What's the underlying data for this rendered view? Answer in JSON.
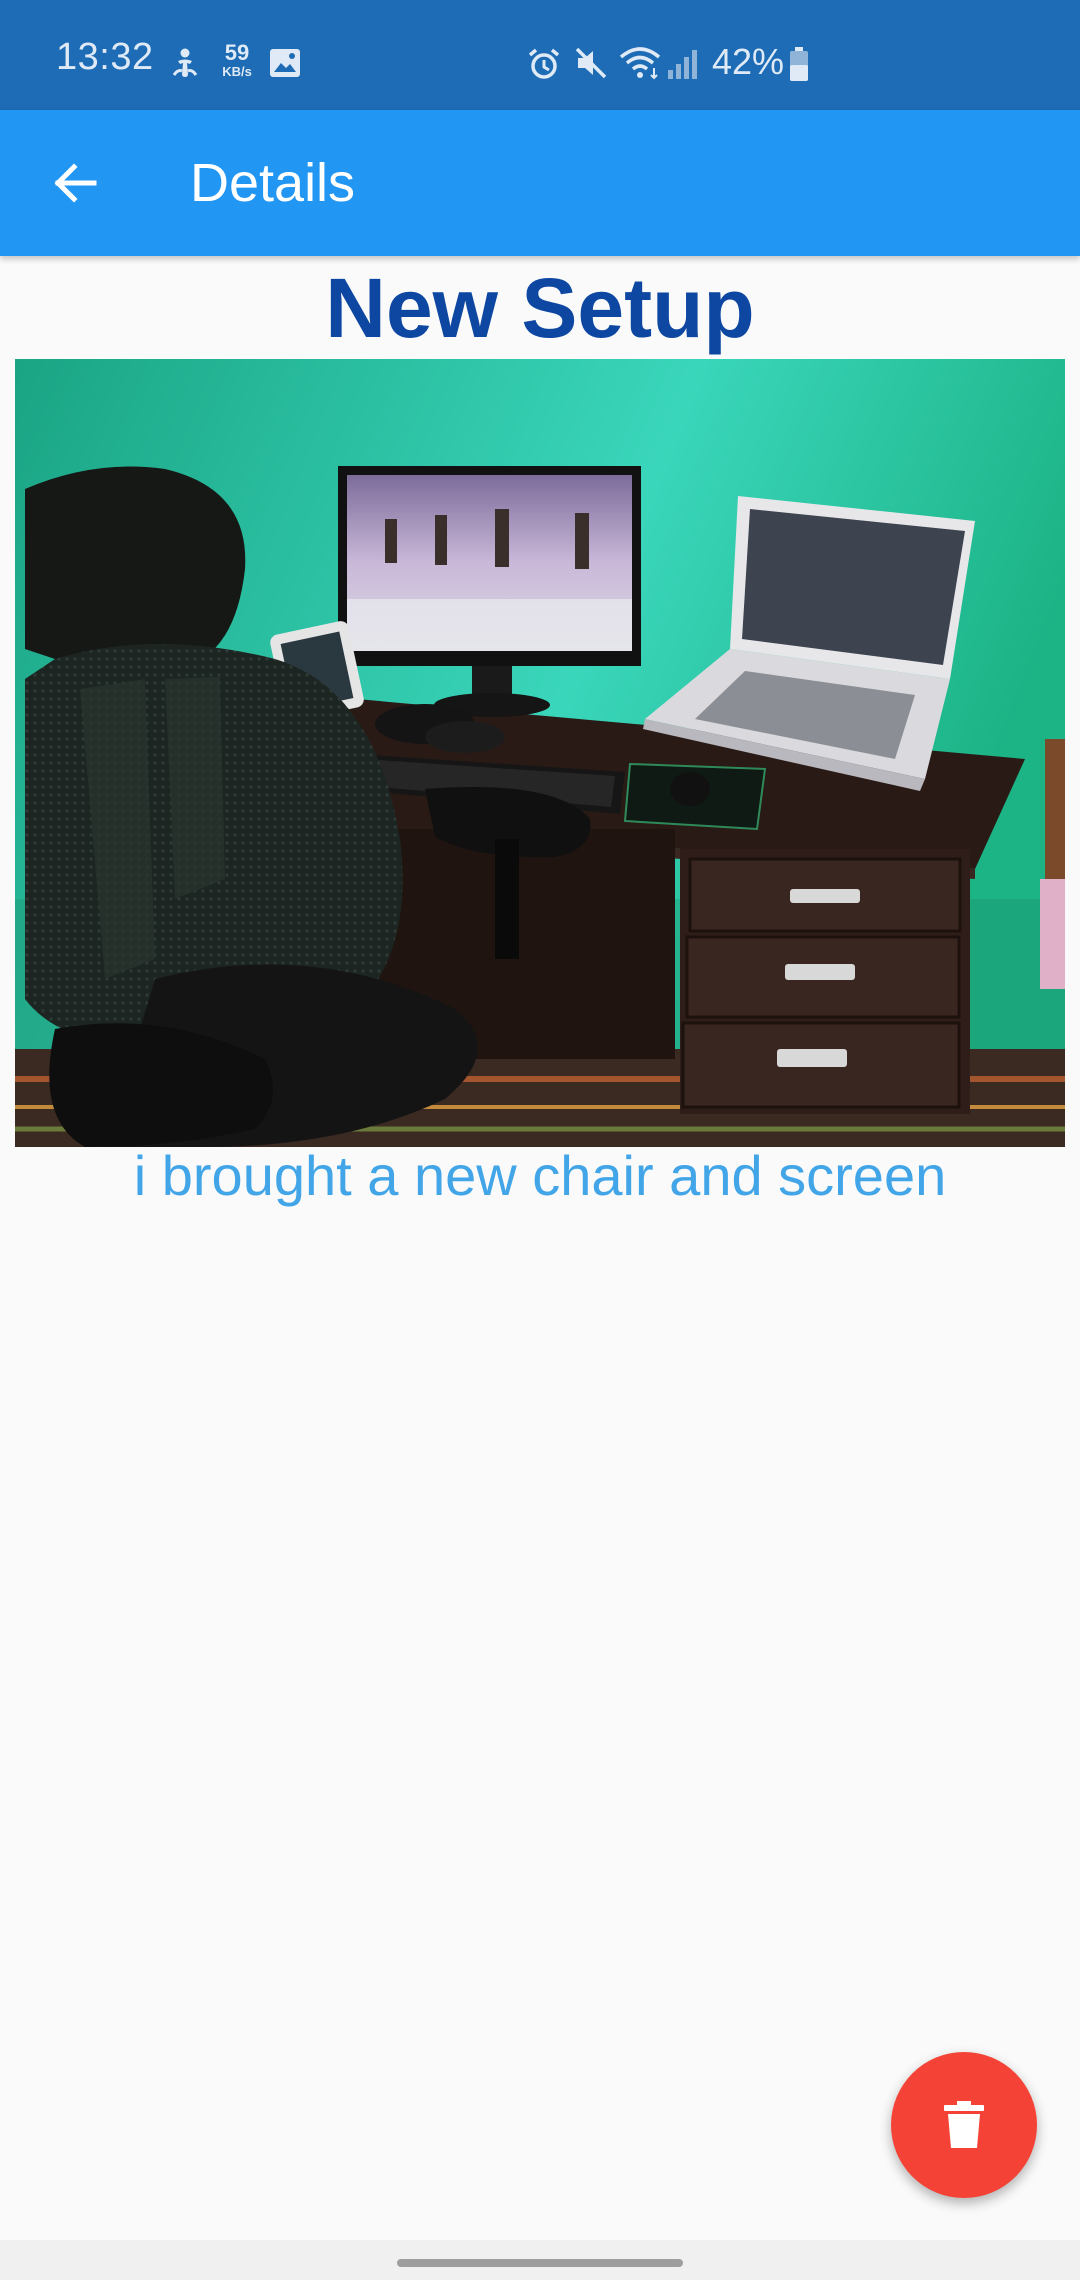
{
  "status_bar": {
    "time": "13:32",
    "net_speed_value": "59",
    "net_speed_unit": "KB/s",
    "battery_percent": "42%",
    "icons": [
      "accessibility-icon",
      "image-icon",
      "alarm-icon",
      "mute-icon",
      "wifi-icon",
      "signal-icon",
      "battery-icon"
    ]
  },
  "app_bar": {
    "title": "Details",
    "back_icon": "arrow-left-icon"
  },
  "post": {
    "title": "New Setup",
    "caption": "i brought a new chair and screen",
    "photo_description": "desk setup photo"
  },
  "fab": {
    "icon": "trash-icon",
    "color": "#f44336"
  },
  "colors": {
    "status_bar": "#1d6cb5",
    "app_bar": "#2196f3",
    "title": "#0d47a1",
    "caption": "#42a5e8"
  }
}
